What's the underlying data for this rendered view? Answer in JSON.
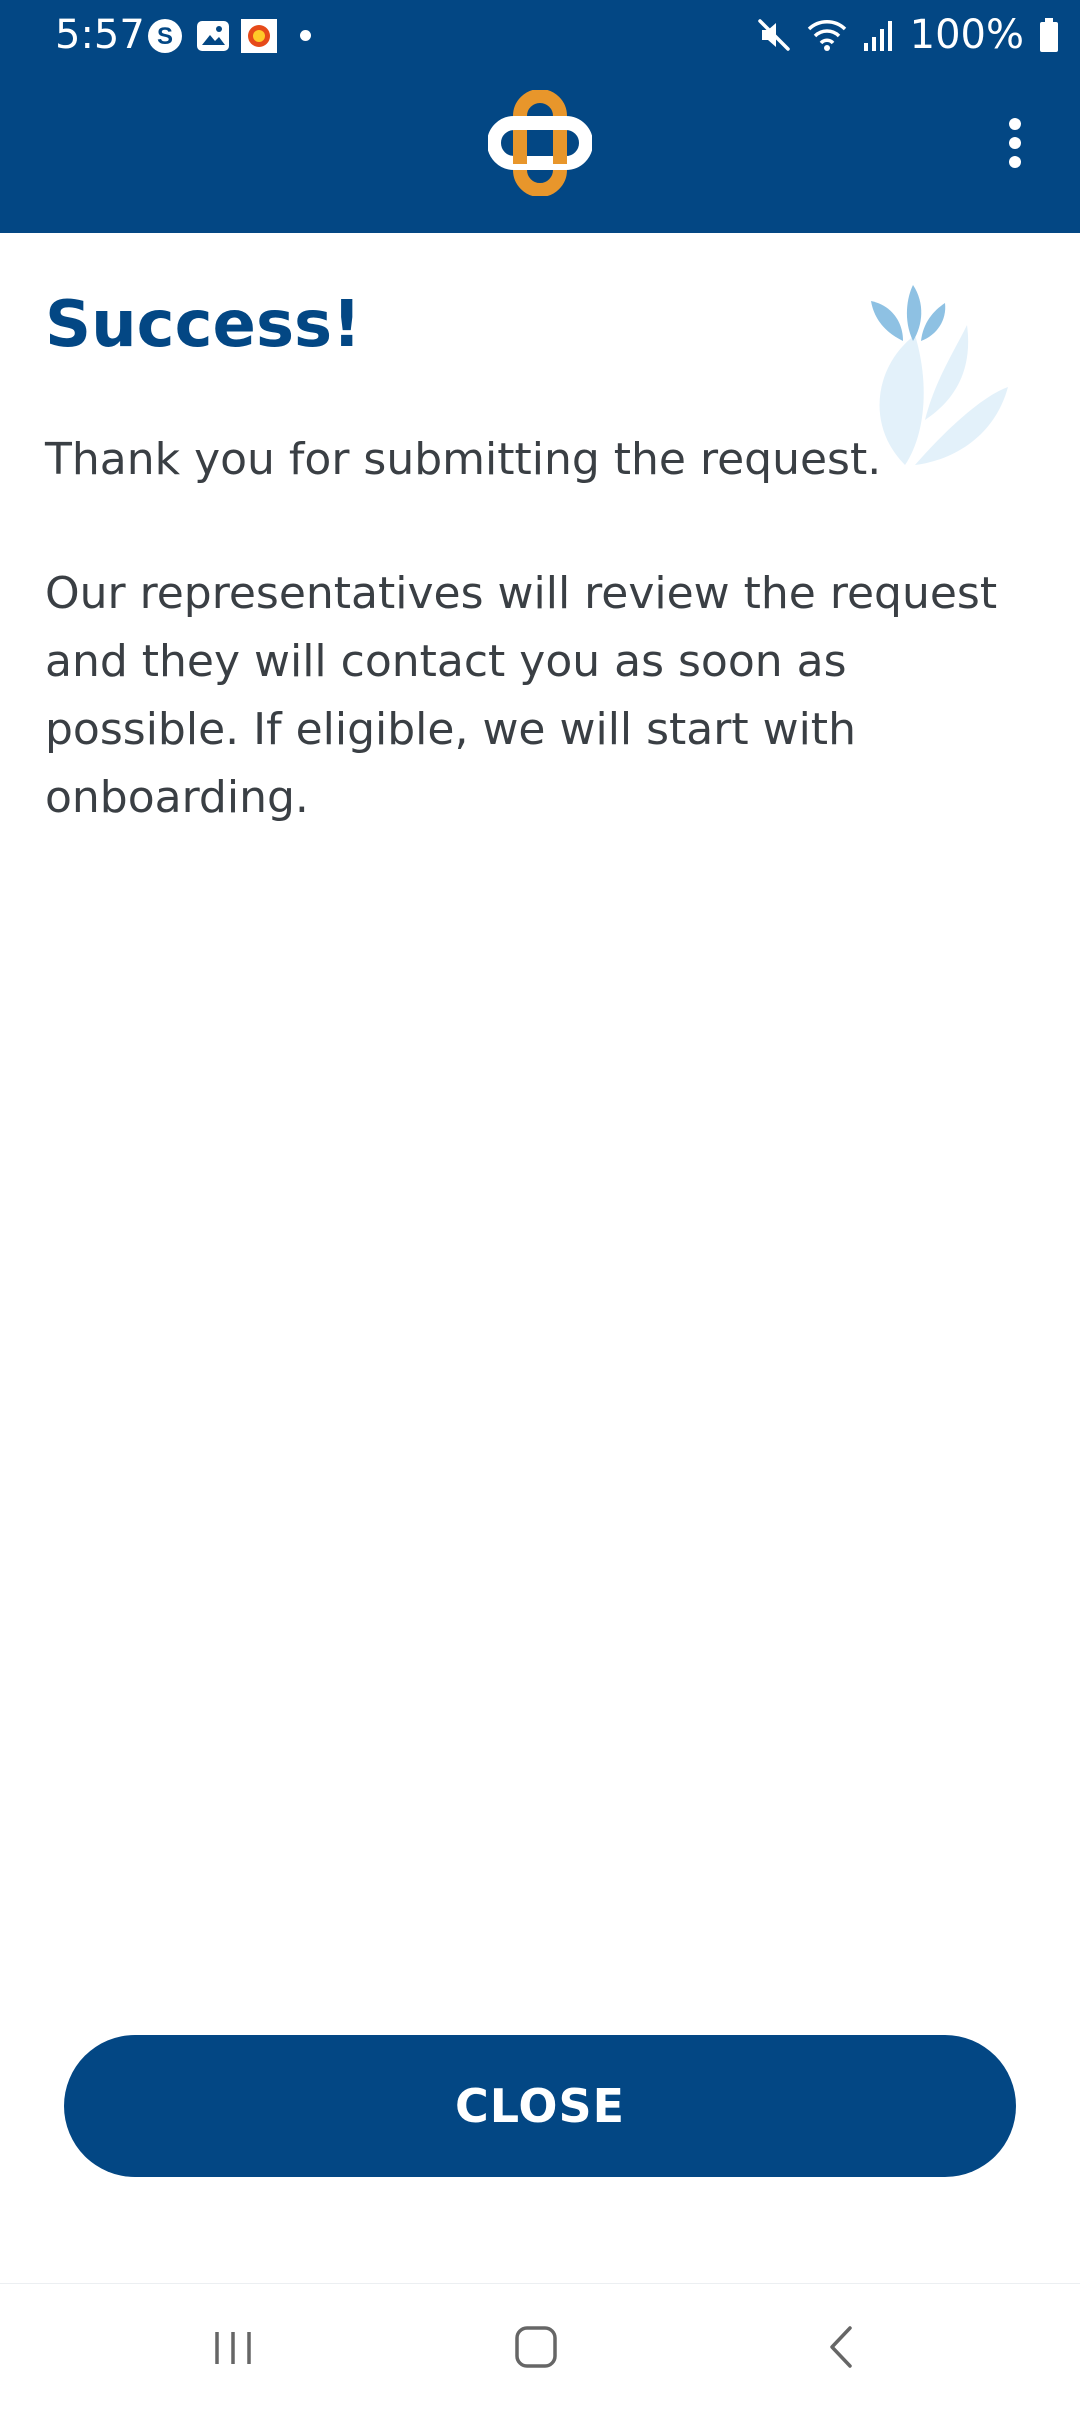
{
  "status_bar": {
    "time": "5:57",
    "battery": "100%",
    "icons": [
      "skype-icon",
      "gallery-icon",
      "app-notification-icon",
      "dot-icon",
      "mute-icon",
      "wifi-icon",
      "signal-icon",
      "battery-icon"
    ]
  },
  "app_bar": {
    "logo": "cross-logo-icon",
    "menu_icon": "more-vert-icon"
  },
  "content": {
    "title": "Success!",
    "line1": "Thank you for submitting the request.",
    "paragraph2": "Our representatives will review the request and they will contact you as soon as possible. If eligible, we will start with onboarding.",
    "decoration": "leaves-icon"
  },
  "actions": {
    "close_label": "CLOSE"
  },
  "nav_bar": {
    "icons": [
      "recents-icon",
      "home-icon",
      "back-icon"
    ]
  },
  "colors": {
    "primary": "#034784",
    "accent": "#E8962B",
    "text": "#3a3f44",
    "leaf_dark": "#8ec1e3",
    "leaf_light": "#e3f1fa"
  }
}
